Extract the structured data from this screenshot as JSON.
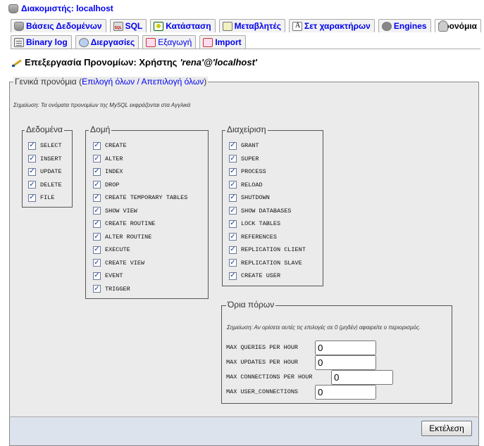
{
  "server": {
    "label": "Διακομιστής: localhost",
    "icon": "server-icon"
  },
  "tabs_row1": [
    {
      "label": "Βάσεις Δεδομένων",
      "icon": "databases-icon"
    },
    {
      "label": "SQL",
      "icon": "sql-icon"
    },
    {
      "label": "Κατάσταση",
      "icon": "status-icon"
    },
    {
      "label": "Μεταβλητές",
      "icon": "variables-icon"
    },
    {
      "label": "Σετ χαρακτήρων",
      "icon": "charsets-icon"
    },
    {
      "label": "Engines",
      "icon": "engines-icon"
    },
    {
      "label": "Προνόμια",
      "icon": "privileges-icon",
      "active": true
    }
  ],
  "tabs_row2": [
    {
      "label": "Binary log",
      "icon": "binlog-icon"
    },
    {
      "label": "Διεργασίες",
      "icon": "processes-icon"
    },
    {
      "label": "Εξαγωγή",
      "icon": "export-icon"
    },
    {
      "label": "Import",
      "icon": "import-icon"
    }
  ],
  "heading": {
    "prefix": "Επεξεργασία Προνομίων: Χρήστης",
    "user": "'rena'@'localhost'"
  },
  "global": {
    "legend": "Γενικά προνόμια",
    "check_all": "Επιλογή όλων",
    "separator": "/",
    "uncheck_all": "Απεπιλογή όλων",
    "note": "Σημείωση: Τα ονόματα προνομίων της MySQL εκφράζονται στα Αγγλικά"
  },
  "groups": {
    "data": {
      "legend": "Δεδομένα",
      "items": [
        "SELECT",
        "INSERT",
        "UPDATE",
        "DELETE",
        "FILE"
      ]
    },
    "structure": {
      "legend": "Δομή",
      "items": [
        "CREATE",
        "ALTER",
        "INDEX",
        "DROP",
        "CREATE TEMPORARY TABLES",
        "SHOW VIEW",
        "CREATE ROUTINE",
        "ALTER ROUTINE",
        "EXECUTE",
        "CREATE VIEW",
        "EVENT",
        "TRIGGER"
      ]
    },
    "admin": {
      "legend": "Διαχείριση",
      "items": [
        "GRANT",
        "SUPER",
        "PROCESS",
        "RELOAD",
        "SHUTDOWN",
        "SHOW DATABASES",
        "LOCK TABLES",
        "REFERENCES",
        "REPLICATION CLIENT",
        "REPLICATION SLAVE",
        "CREATE USER"
      ]
    }
  },
  "checkbox_mark": "✓",
  "limits": {
    "legend": "Όρια πόρων",
    "note": "Σημείωση: Αν ορίσετε αυτές τις επιλογές σε 0 (μηδέν) αφαιρείτε ο περιορισμός.",
    "items": [
      {
        "label": "MAX QUERIES PER HOUR",
        "value": "0"
      },
      {
        "label": "MAX UPDATES PER HOUR",
        "value": "0"
      },
      {
        "label": "MAX CONNECTIONS PER HOUR",
        "value": "0"
      },
      {
        "label": "MAX USER_CONNECTIONS",
        "value": "0"
      }
    ]
  },
  "submit_label": "Εκτέλεση"
}
